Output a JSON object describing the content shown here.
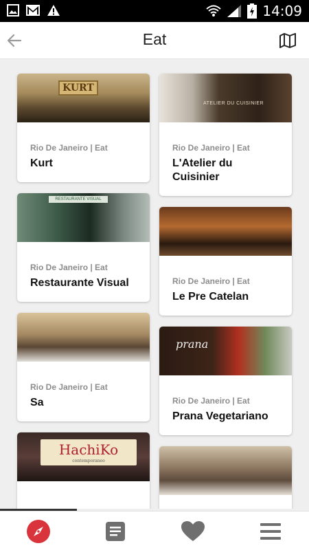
{
  "status_bar": {
    "time": "14:09",
    "icons": [
      "image-icon",
      "gmail-icon",
      "warning-icon",
      "wifi-icon",
      "signal-icon",
      "battery-icon"
    ]
  },
  "appbar": {
    "title": "Eat",
    "back_icon": "arrow-left-icon",
    "map_icon": "map-icon"
  },
  "cards_left": [
    {
      "meta": "Rio De Janeiro | Eat",
      "name": "Kurt",
      "image": "kurt-storefront"
    },
    {
      "meta": "Rio De Janeiro | Eat",
      "name": "Restaurante Visual",
      "image": "visual-storefront"
    },
    {
      "meta": "Rio De Janeiro | Eat",
      "name": "Sa",
      "image": "sa-dining-room"
    },
    {
      "meta": "",
      "name": "",
      "image": "hachiko-sign"
    }
  ],
  "cards_right": [
    {
      "meta": "Rio De Janeiro | Eat",
      "name": "L'Atelier du Cuisinier",
      "image": "atelier-facade"
    },
    {
      "meta": "Rio De Janeiro | Eat",
      "name": "Le Pre Catelan",
      "image": "catelan-dining-room"
    },
    {
      "meta": "Rio De Janeiro | Eat",
      "name": "Prana Vegetariano",
      "image": "prana-storefront"
    },
    {
      "meta": "",
      "name": "",
      "image": "hotel-dining-room"
    }
  ],
  "image_text": {
    "kurt": "KURT",
    "atelier": "ATELIER DU CUISINIER",
    "visual": "RESTAURANTE VISUAL",
    "prana": "prana",
    "hachiko": "HachiKo",
    "hachiko_sub": "contemporaneo"
  },
  "bottom_nav": [
    {
      "icon": "compass-icon",
      "active": true
    },
    {
      "icon": "list-icon",
      "active": false
    },
    {
      "icon": "heart-icon",
      "active": false
    },
    {
      "icon": "menu-icon",
      "active": false
    }
  ],
  "colors": {
    "accent": "#d9343c",
    "icon_gray": "#6f6f6f",
    "meta_gray": "#8c8c8c",
    "background": "#efefef"
  }
}
